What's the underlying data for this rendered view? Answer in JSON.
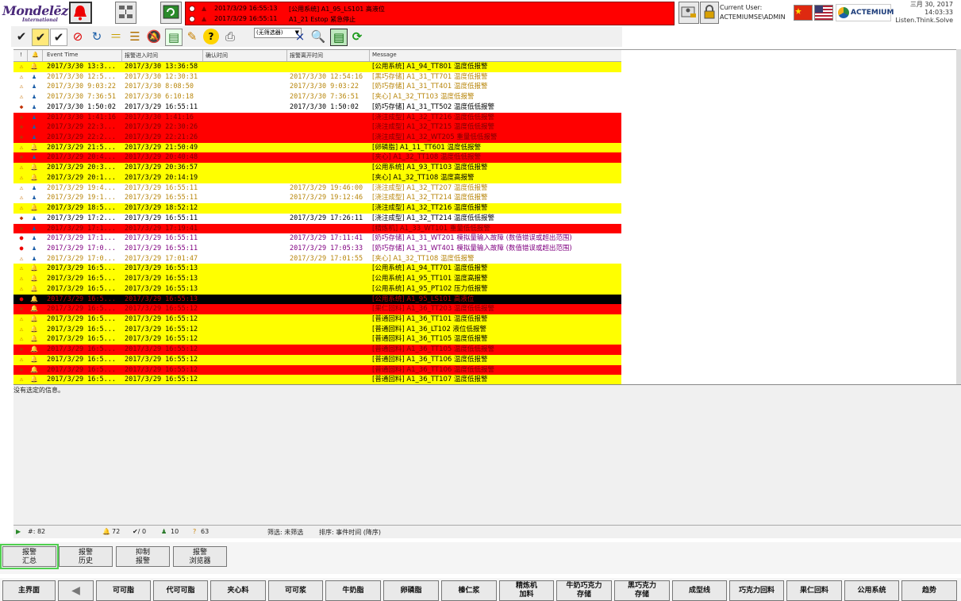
{
  "header": {
    "logo_main": "Mondelēz",
    "logo_sub": "International",
    "user_label": "Current User:",
    "user_name": "ACTEMIUMSE\\ADMIN",
    "brand": "ACTEMIUM",
    "date": "三月 30, 2017",
    "time": "14:03:33",
    "slogan": "Listen.Think.Solve",
    "alarms": [
      {
        "bell": "▲",
        "time": "2017/3/29 16:55:13",
        "msg": "[公用系统] A1_95_LS101 高液位"
      },
      {
        "bell": "▲",
        "time": "2017/3/29 16:55:11",
        "msg": "A1_21 Estop 紧急停止"
      }
    ]
  },
  "toolbar": {
    "filter_select": "(无筛选器)"
  },
  "grid": {
    "headers": [
      "!",
      "🔔",
      "Event Time",
      "报警进入时间",
      "确认时间",
      "报警离开时间",
      "Message"
    ],
    "rows": [
      {
        "bg": "#ffff00",
        "fg": "#000",
        "i1": "⚠",
        "i2": "🔔",
        "c1": "2017/3/30 13:3...",
        "c2": "2017/3/30 13:36:58",
        "c3": "",
        "c4": "[公用系统] A1_94_TT801 温度低报警"
      },
      {
        "bg": "#ffffff",
        "fg": "#b8860b",
        "i1": "⚠",
        "i2": "♟",
        "c1": "2017/3/30 12:5...",
        "c2": "2017/3/30 12:30:31",
        "c3": "2017/3/30 12:54:16",
        "c4": "[黑巧存储] A1_31_TT701 温度低报警"
      },
      {
        "bg": "#ffffff",
        "fg": "#b8860b",
        "i1": "⚠",
        "i2": "♟",
        "c1": "2017/3/30 9:03:22",
        "c2": "2017/3/30 8:08:50",
        "c3": "2017/3/30 9:03:22",
        "c4": "[奶巧存储] A1_31_TT401 温度低报警"
      },
      {
        "bg": "#ffffff",
        "fg": "#b8860b",
        "i1": "⚠",
        "i2": "♟",
        "c1": "2017/3/30 7:36:51",
        "c2": "2017/3/30 6:10:18",
        "c3": "2017/3/30 7:36:51",
        "c4": "[夹心] A1_32_TT103 温度低报警"
      },
      {
        "bg": "#ffffff",
        "fg": "#000",
        "i1": "◆",
        "i2": "♟",
        "c1": "2017/3/30 1:50:02",
        "c2": "2017/3/29 16:55:11",
        "c3": "2017/3/30 1:50:02",
        "c4": "[奶巧存储] A1_31_TT502 温度低低报警"
      },
      {
        "bg": "#ff0000",
        "fg": "#7a0000",
        "i1": "◆",
        "i2": "♟",
        "c1": "2017/3/30 1:41:16",
        "c2": "2017/3/30 1:41:16",
        "c3": "",
        "c4": "[浇注成型] A1_32_TT216 温度低低报警"
      },
      {
        "bg": "#ff0000",
        "fg": "#7a0000",
        "i1": "◆",
        "i2": "♟",
        "c1": "2017/3/29 22:3...",
        "c2": "2017/3/29 22:30:26",
        "c3": "",
        "c4": "[浇注成型] A1_32_TT215 温度低低报警"
      },
      {
        "bg": "#ff0000",
        "fg": "#7a0000",
        "i1": "◆",
        "i2": "♟",
        "c1": "2017/3/29 22:2...",
        "c2": "2017/3/29 22:21:26",
        "c3": "",
        "c4": "[浇注成型] A1_32_WT205 重量低低报警"
      },
      {
        "bg": "#ffff00",
        "fg": "#000",
        "i1": "⚠",
        "i2": "🔔",
        "c1": "2017/3/29 21:5...",
        "c2": "2017/3/29 21:50:49",
        "c3": "",
        "c4": "[卵磷脂] A1_11_TT601 温度低报警"
      },
      {
        "bg": "#ff0000",
        "fg": "#7a0000",
        "i1": "◆",
        "i2": "♟",
        "c1": "2017/3/29 20:4...",
        "c2": "2017/3/29 20:40:48",
        "c3": "",
        "c4": "[夹心] A1_32_TT108 温度低低报警"
      },
      {
        "bg": "#ffff00",
        "fg": "#000",
        "i1": "⚠",
        "i2": "🔔",
        "c1": "2017/3/29 20:3...",
        "c2": "2017/3/29 20:36:57",
        "c3": "",
        "c4": "[公用系统] A1_93_TT103 温度低报警"
      },
      {
        "bg": "#ffff00",
        "fg": "#000",
        "i1": "⚠",
        "i2": "🔔",
        "c1": "2017/3/29 20:1...",
        "c2": "2017/3/29 20:14:19",
        "c3": "",
        "c4": "[夹心] A1_32_TT108 温度高报警"
      },
      {
        "bg": "#ffffff",
        "fg": "#b8860b",
        "i1": "⚠",
        "i2": "♟",
        "c1": "2017/3/29 19:4...",
        "c2": "2017/3/29 16:55:11",
        "c3": "2017/3/29 19:46:00",
        "c4": "[浇注成型] A1_32_TT207 温度低报警"
      },
      {
        "bg": "#ffffff",
        "fg": "#b8860b",
        "i1": "⚠",
        "i2": "♟",
        "c1": "2017/3/29 19:1...",
        "c2": "2017/3/29 16:55:11",
        "c3": "2017/3/29 19:12:46",
        "c4": "[浇注成型] A1_32_TT214 温度低报警"
      },
      {
        "bg": "#ffff00",
        "fg": "#000",
        "i1": "⚠",
        "i2": "🔔",
        "c1": "2017/3/29 18:5...",
        "c2": "2017/3/29 18:52:12",
        "c3": "",
        "c4": "[浇注成型] A1_32_TT216 温度低报警"
      },
      {
        "bg": "#ffffff",
        "fg": "#000",
        "i1": "◆",
        "i2": "♟",
        "c1": "2017/3/29 17:2...",
        "c2": "2017/3/29 16:55:11",
        "c3": "2017/3/29 17:26:11",
        "c4": "[浇注成型] A1_32_TT214 温度低低报警"
      },
      {
        "bg": "#ff0000",
        "fg": "#7a0000",
        "i1": "◆",
        "i2": "♟",
        "c1": "2017/3/29 17:1...",
        "c2": "2017/3/29 17:19:41",
        "c3": "",
        "c4": "[精炼机] A1_33_WT101 重量低低报警"
      },
      {
        "bg": "#ffffff",
        "fg": "#800080",
        "i1": "●",
        "i2": "♟",
        "c1": "2017/3/29 17:1...",
        "c2": "2017/3/29 16:55:11",
        "c3": "2017/3/29 17:11:41",
        "c4": "[奶巧存储] A1_31_WT201 模拟量输入故障 (数值错误或超出范围)"
      },
      {
        "bg": "#ffffff",
        "fg": "#800080",
        "i1": "●",
        "i2": "♟",
        "c1": "2017/3/29 17:0...",
        "c2": "2017/3/29 16:55:11",
        "c3": "2017/3/29 17:05:33",
        "c4": "[奶巧存储] A1_31_WT401 模拟量输入故障 (数值错误或超出范围)"
      },
      {
        "bg": "#ffffff",
        "fg": "#b8860b",
        "i1": "⚠",
        "i2": "♟",
        "c1": "2017/3/29 17:0...",
        "c2": "2017/3/29 17:01:47",
        "c3": "2017/3/29 17:01:55",
        "c4": "[夹心] A1_32_TT108 温度低报警"
      },
      {
        "bg": "#ffff00",
        "fg": "#000",
        "i1": "⚠",
        "i2": "🔔",
        "c1": "2017/3/29 16:5...",
        "c2": "2017/3/29 16:55:13",
        "c3": "",
        "c4": "[公用系统] A1_94_TT701 温度低报警"
      },
      {
        "bg": "#ffff00",
        "fg": "#000",
        "i1": "⚠",
        "i2": "🔔",
        "c1": "2017/3/29 16:5...",
        "c2": "2017/3/29 16:55:13",
        "c3": "",
        "c4": "[公用系统] A1_95_TT101 温度高报警"
      },
      {
        "bg": "#ffff00",
        "fg": "#000",
        "i1": "⚠",
        "i2": "🔔",
        "c1": "2017/3/29 16:5...",
        "c2": "2017/3/29 16:55:13",
        "c3": "",
        "c4": "[公用系统] A1_95_PT102 压力低报警"
      },
      {
        "bg": "#000000",
        "fg": "#cc0000",
        "i1": "●",
        "i2": "🔔",
        "c1": "2017/3/29 16:5...",
        "c2": "2017/3/29 16:55:13",
        "c3": "",
        "c4": "[公用系统] A1_95_LS101 高液位"
      },
      {
        "bg": "#ff0000",
        "fg": "#7a0000",
        "i1": "◆",
        "i2": "🔔",
        "c1": "2017/3/29 16:5...",
        "c2": "2017/3/29 16:55:12",
        "c3": "",
        "c4": "[果仁回料] A1_36_TT203 温度低低报警"
      },
      {
        "bg": "#ffff00",
        "fg": "#000",
        "i1": "⚠",
        "i2": "🔔",
        "c1": "2017/3/29 16:5...",
        "c2": "2017/3/29 16:55:12",
        "c3": "",
        "c4": "[普通回料] A1_36_TT101 温度低报警"
      },
      {
        "bg": "#ffff00",
        "fg": "#000",
        "i1": "⚠",
        "i2": "🔔",
        "c1": "2017/3/29 16:5...",
        "c2": "2017/3/29 16:55:12",
        "c3": "",
        "c4": "[普通回料] A1_36_LT102 液位低报警"
      },
      {
        "bg": "#ffff00",
        "fg": "#000",
        "i1": "⚠",
        "i2": "🔔",
        "c1": "2017/3/29 16:5...",
        "c2": "2017/3/29 16:55:12",
        "c3": "",
        "c4": "[普通回料] A1_36_TT105 温度低报警"
      },
      {
        "bg": "#ff0000",
        "fg": "#7a0000",
        "i1": "◆",
        "i2": "🔔",
        "c1": "2017/3/29 16:5...",
        "c2": "2017/3/29 16:55:12",
        "c3": "",
        "c4": "[普通回料] A1_36_TT105 温度低低报警"
      },
      {
        "bg": "#ffff00",
        "fg": "#000",
        "i1": "⚠",
        "i2": "🔔",
        "c1": "2017/3/29 16:5...",
        "c2": "2017/3/29 16:55:12",
        "c3": "",
        "c4": "[普通回料] A1_36_TT106 温度低报警"
      },
      {
        "bg": "#ff0000",
        "fg": "#7a0000",
        "i1": "◆",
        "i2": "🔔",
        "c1": "2017/3/29 16:5...",
        "c2": "2017/3/29 16:55:12",
        "c3": "",
        "c4": "[普通回料] A1_36_TT106 温度低低报警"
      },
      {
        "bg": "#ffff00",
        "fg": "#000",
        "i1": "⚠",
        "i2": "🔔",
        "c1": "2017/3/29 16:5...",
        "c2": "2017/3/29 16:55:12",
        "c3": "",
        "c4": "[普通回料] A1_36_TT107 温度低报警"
      }
    ]
  },
  "detail": {
    "label": "没有选定的信息。"
  },
  "status": {
    "total": "82",
    "active": "72",
    "acked": "0",
    "inactive": "10",
    "unacked": "63",
    "filter": "筛选: 未筛选",
    "sort": "排序: 事件时间 (降序)"
  },
  "tabs": [
    [
      "报警",
      "汇总"
    ],
    [
      "报警",
      "历史"
    ],
    [
      "抑制",
      "报警"
    ],
    [
      "报警",
      "浏览器"
    ]
  ],
  "nav": [
    "主界面",
    "◀",
    "可可脂",
    "代可可脂",
    "夹心料",
    "可可浆",
    "牛奶脂",
    "卵磷脂",
    "榛仁浆",
    "精炼机\n加料",
    "牛奶巧克力\n存储",
    "黑巧克力\n存储",
    "成型线",
    "巧克力回料",
    "果仁回料",
    "公用系统",
    "趋势"
  ]
}
